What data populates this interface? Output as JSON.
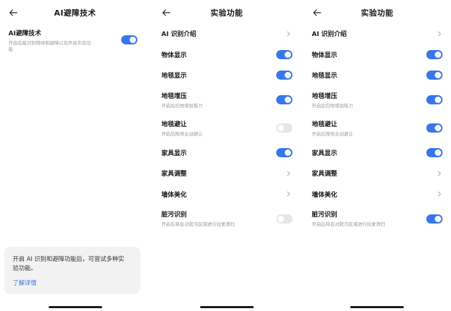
{
  "screen1": {
    "title": "AI避障技术",
    "setting": {
      "label": "AI避障技术",
      "sub_line1": "开启后能识别物体和避障以及开启实验功",
      "sub_line2": "能",
      "on": true
    },
    "card": {
      "message_line1": "开启 AI 识别和避障功能后，可尝试多种实",
      "message_line2": "验功能。",
      "link": "了解详情"
    }
  },
  "screen2": {
    "title": "实验功能",
    "items": [
      {
        "label": "AI 识别介绍",
        "control": "chevron"
      },
      {
        "label": "物体显示",
        "control": "toggle",
        "on": true
      },
      {
        "label": "地毯显示",
        "control": "toggle",
        "on": true
      },
      {
        "label": "地毯增压",
        "sub": "开启后扫地增加吸力",
        "control": "toggle",
        "on": true
      },
      {
        "label": "地毯避让",
        "sub": "开启后拖地主动避让",
        "control": "toggle",
        "on": false
      },
      {
        "label": "家具显示",
        "control": "toggle",
        "on": true
      },
      {
        "label": "家具调整",
        "control": "chevron"
      },
      {
        "label": "墙体美化",
        "control": "chevron"
      },
      {
        "label": "脏污识别",
        "sub": "开启后将会对脏污区域进行往复清扫",
        "control": "toggle",
        "on": false
      }
    ]
  },
  "screen3": {
    "title": "实验功能",
    "items": [
      {
        "label": "AI 识别介绍",
        "control": "chevron"
      },
      {
        "label": "物体显示",
        "control": "toggle",
        "on": true
      },
      {
        "label": "地毯显示",
        "control": "toggle",
        "on": true
      },
      {
        "label": "地毯增压",
        "sub": "开启后扫地增加吸力",
        "control": "toggle",
        "on": true
      },
      {
        "label": "地毯避让",
        "sub": "开启后拖地主动避让",
        "control": "toggle",
        "on": true
      },
      {
        "label": "家具显示",
        "control": "toggle",
        "on": true
      },
      {
        "label": "家具调整",
        "control": "chevron"
      },
      {
        "label": "墙体美化",
        "control": "chevron"
      },
      {
        "label": "脏污识别",
        "sub": "开启后将会对脏污区域进行往复清扫",
        "control": "toggle",
        "on": true
      }
    ]
  },
  "colors": {
    "accent": "#3877e8",
    "toggle_off": "#e6e6e6",
    "card_bg": "#f2f2f2",
    "subtext": "#9a9a9a"
  },
  "icons": {
    "back": "arrow-left-icon",
    "chevron": "chevron-right-icon"
  }
}
